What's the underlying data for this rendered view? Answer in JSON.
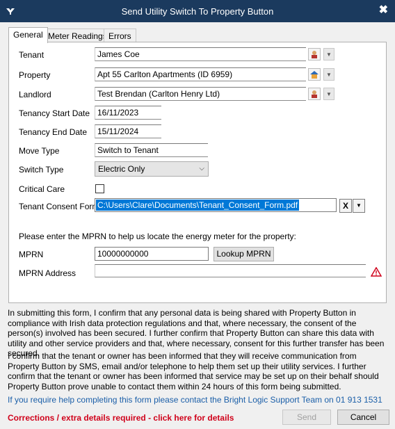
{
  "window": {
    "title": "Send Utility Switch To Property Button",
    "close_label": "✖"
  },
  "tabs": [
    "General",
    "Meter Readings",
    "Errors"
  ],
  "form": {
    "tenant_label": "Tenant",
    "tenant_value": "James Coe",
    "property_label": "Property",
    "property_value": "Apt 55 Carlton Apartments  (ID 6959)",
    "landlord_label": "Landlord",
    "landlord_value": "Test Brendan (Carlton Henry Ltd)",
    "start_label": "Tenancy Start Date",
    "start_value": "16/11/2023",
    "end_label": "Tenancy End Date",
    "end_value": "15/11/2024",
    "move_label": "Move Type",
    "move_value": "Switch to Tenant",
    "switch_label": "Switch Type",
    "switch_value": "Electric Only",
    "care_label": "Critical Care",
    "consent_label": "Tenant Consent Form",
    "consent_value": "C:\\Users\\Clare\\Documents\\Tenant_Consent_Form.pdf",
    "clear_label": "X"
  },
  "mprn": {
    "prompt": "Please enter the MPRN to help us locate the energy meter for the property:",
    "label": "MPRN",
    "value": "10000000000",
    "lookup_label": "Lookup MPRN",
    "address_label": "MPRN Address",
    "address_value": ""
  },
  "footer": {
    "para1": "In submitting this form, I confirm that any personal data is being shared with Property Button in compliance with Irish data protection regulations and that, where necessary, the consent of the person(s) involved has been secured. I further confirm that Property Button can share this data with utility and other service providers and that, where necessary, consent for this further transfer has been secured.",
    "para2": "I confirm that the tenant or owner has been informed that they will receive communication from Property Button by SMS, email and/or telephone to help them set up their utility services. I further confirm that the tenant or owner has been informed that service may be set up on their behalf should Property Button prove unable to contact them within 24 hours of this form being submitted.",
    "help": "If you require help completing this form please contact the Bright Logic Support Team on 01 913 1531",
    "corrections": "Corrections / extra details required - click here for details",
    "send_label": "Send",
    "cancel_label": "Cancel"
  },
  "colors": {
    "titlebar": "#1b3a5e",
    "selection": "#0078d7",
    "help_link": "#1a5ea8",
    "warning": "#d0021b"
  }
}
